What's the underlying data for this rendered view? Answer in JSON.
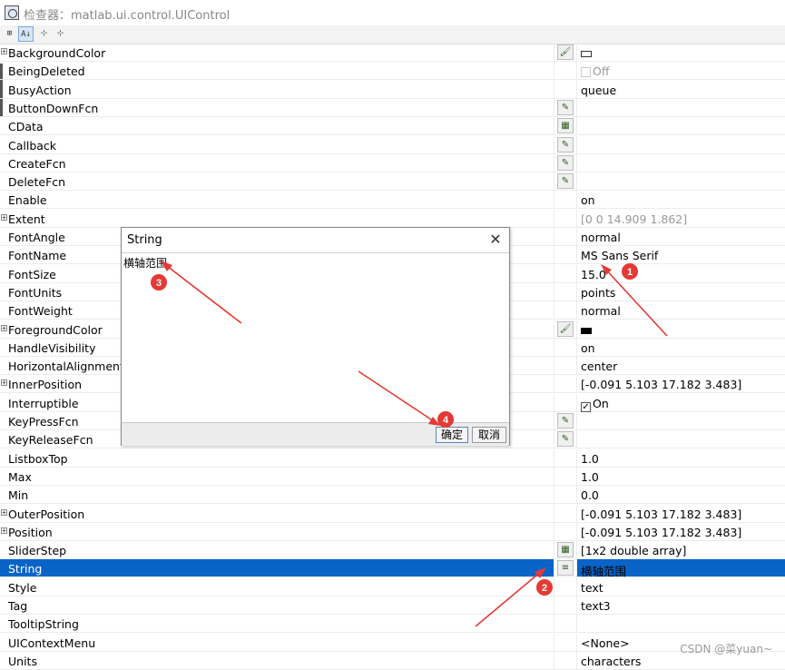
{
  "window": {
    "title": "检查器：matlab.ui.control.UIControl"
  },
  "toolbar": {
    "buttons": [
      {
        "name": "sort-by-category-button",
        "glyph": "⊞"
      },
      {
        "name": "sort-alphabetical-button",
        "glyph": "A↓"
      },
      {
        "name": "expand-all-button",
        "glyph": "⊹"
      },
      {
        "name": "collapse-all-button",
        "glyph": "⊹"
      }
    ]
  },
  "properties": [
    {
      "name": "BackgroundColor",
      "expand": "+",
      "edit": "color",
      "value": "",
      "swatch": "white"
    },
    {
      "name": "BeingDeleted",
      "value": "Off",
      "checkbox": "disabled",
      "grey": true
    },
    {
      "name": "BusyAction",
      "value": "queue"
    },
    {
      "name": "ButtonDownFcn",
      "edit": "fcn",
      "value": ""
    },
    {
      "name": "CData",
      "edit": "array",
      "value": ""
    },
    {
      "name": "Callback",
      "edit": "fcn",
      "value": ""
    },
    {
      "name": "CreateFcn",
      "edit": "fcn",
      "value": ""
    },
    {
      "name": "DeleteFcn",
      "edit": "fcn",
      "value": ""
    },
    {
      "name": "Enable",
      "value": "on"
    },
    {
      "name": "Extent",
      "expand": "+",
      "value": "[0 0 14.909 1.862]",
      "grey": true
    },
    {
      "name": "FontAngle",
      "value": "normal"
    },
    {
      "name": "FontName",
      "value": "MS Sans Serif"
    },
    {
      "name": "FontSize",
      "value": "15.0"
    },
    {
      "name": "FontUnits",
      "value": "points"
    },
    {
      "name": "FontWeight",
      "value": "normal"
    },
    {
      "name": "ForegroundColor",
      "expand": "+",
      "edit": "color",
      "value": "",
      "swatch": "black"
    },
    {
      "name": "HandleVisibility",
      "value": "on"
    },
    {
      "name": "HorizontalAlignment",
      "value": "center"
    },
    {
      "name": "InnerPosition",
      "expand": "+",
      "value": "[-0.091 5.103 17.182 3.483]"
    },
    {
      "name": "Interruptible",
      "value": "On",
      "checkbox": "checked"
    },
    {
      "name": "KeyPressFcn",
      "edit": "fcn",
      "value": ""
    },
    {
      "name": "KeyReleaseFcn",
      "edit": "fcn",
      "value": ""
    },
    {
      "name": "ListboxTop",
      "value": "1.0"
    },
    {
      "name": "Max",
      "value": "1.0"
    },
    {
      "name": "Min",
      "value": "0.0"
    },
    {
      "name": "OuterPosition",
      "expand": "+",
      "value": "[-0.091 5.103 17.182 3.483]"
    },
    {
      "name": "Position",
      "expand": "+",
      "value": "[-0.091 5.103 17.182 3.483]"
    },
    {
      "name": "SliderStep",
      "edit": "array",
      "value": "[1x2  double array]"
    },
    {
      "name": "String",
      "edit": "text",
      "value": "横轴范围",
      "selected": true
    },
    {
      "name": "Style",
      "value": "text"
    },
    {
      "name": "Tag",
      "value": "text3"
    },
    {
      "name": "TooltipString",
      "value": ""
    },
    {
      "name": "UIContextMenu",
      "value": "<None>"
    },
    {
      "name": "Units",
      "value": "characters"
    }
  ],
  "edit_glyphs": {
    "fcn": "✎",
    "array": "▦",
    "color": "🖌",
    "text": "≡"
  },
  "dialog": {
    "title": "String",
    "content": "横轴范围",
    "close_glyph": "✕",
    "ok_label": "确定",
    "cancel_label": "取消"
  },
  "annotations": {
    "markers": [
      "1",
      "2",
      "3",
      "4"
    ],
    "arrow_color": "#e53935"
  },
  "watermark": "CSDN @菜yuan~"
}
